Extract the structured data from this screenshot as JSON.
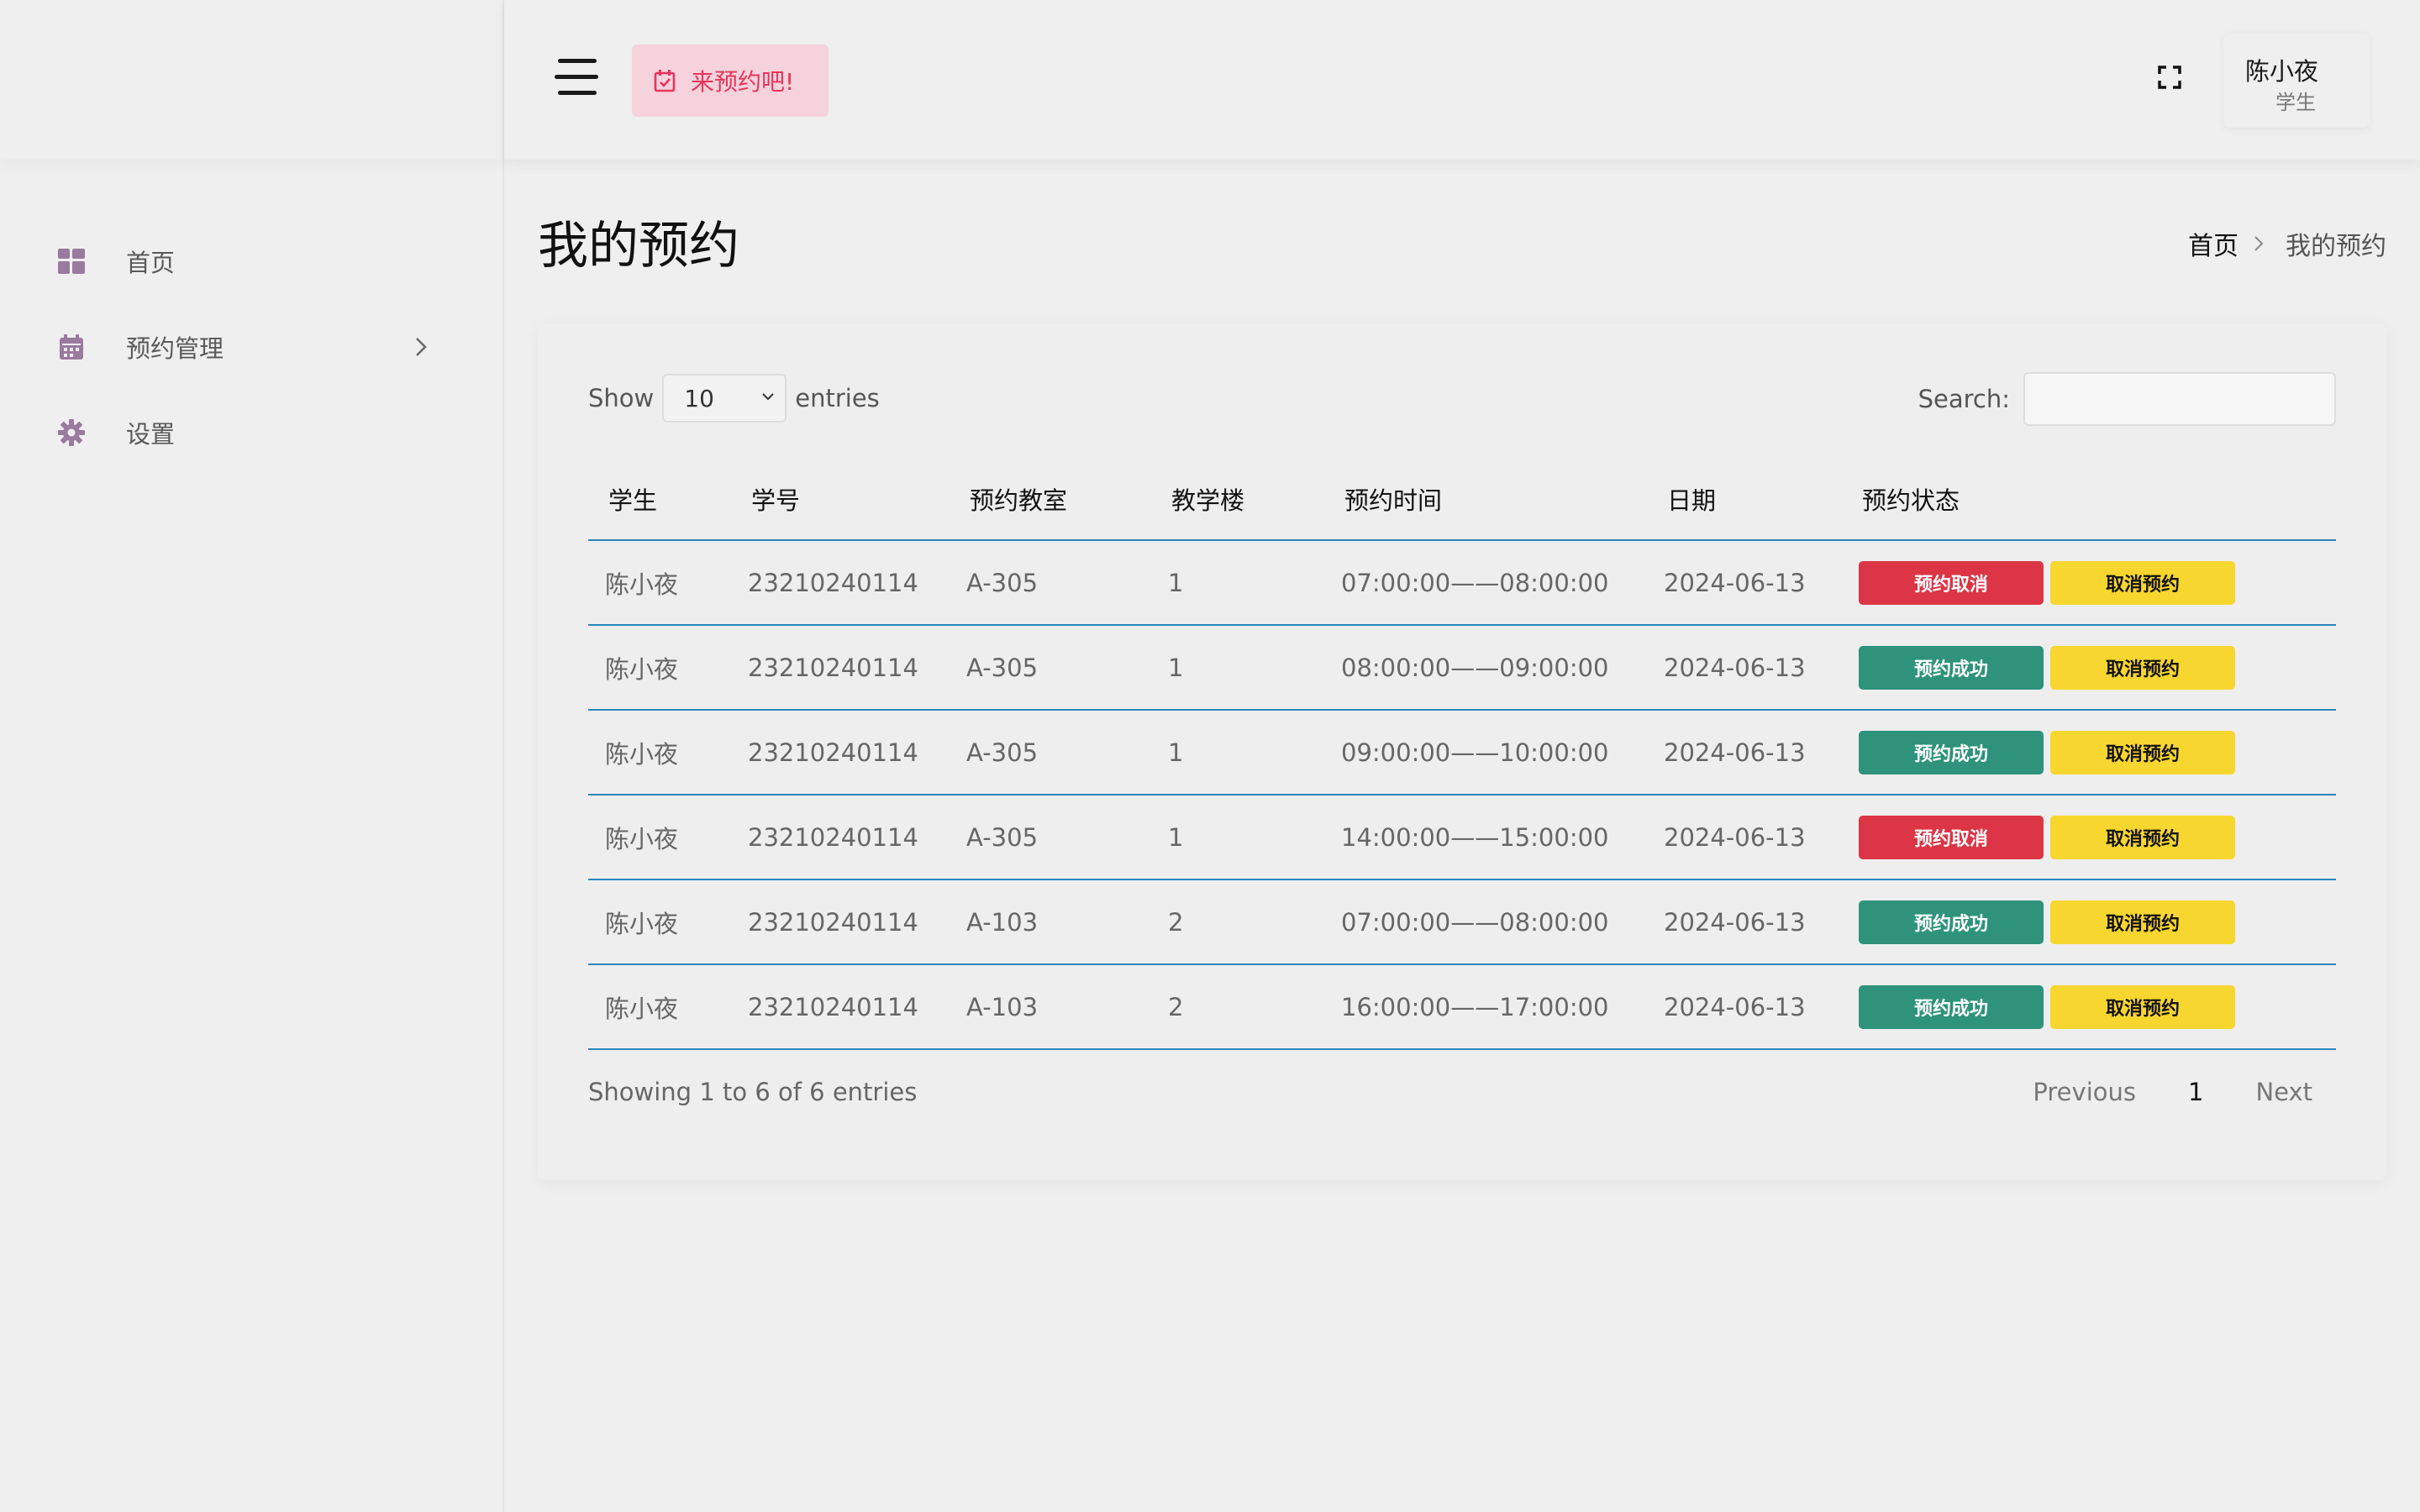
{
  "sidebar": {
    "items": [
      {
        "label": "首页",
        "icon": "dashboard-grid-icon"
      },
      {
        "label": "预约管理",
        "icon": "calendar-icon"
      },
      {
        "label": "设置",
        "icon": "gear-icon"
      }
    ]
  },
  "header": {
    "book_button_label": "来预约吧!",
    "user_name": "陈小夜",
    "user_role": "学生"
  },
  "page": {
    "title": "我的预约",
    "breadcrumb_home": "首页",
    "breadcrumb_current": "我的预约"
  },
  "table_controls": {
    "show_label": "Show",
    "entries_value": "10",
    "entries_label": "entries",
    "search_label": "Search:",
    "search_value": ""
  },
  "table": {
    "columns": [
      "学生",
      "学号",
      "预约教室",
      "教学楼",
      "预约时间",
      "日期",
      "预约状态"
    ],
    "rows": [
      {
        "student": "陈小夜",
        "id": "23210240114",
        "room": "A-305",
        "building": "1",
        "time": "07:00:00——08:00:00",
        "date": "2024-06-13",
        "status": "预约取消",
        "status_color": "#dc3545",
        "action": "取消预约"
      },
      {
        "student": "陈小夜",
        "id": "23210240114",
        "room": "A-305",
        "building": "1",
        "time": "08:00:00——09:00:00",
        "date": "2024-06-13",
        "status": "预约成功",
        "status_color": "#2e937a",
        "action": "取消预约"
      },
      {
        "student": "陈小夜",
        "id": "23210240114",
        "room": "A-305",
        "building": "1",
        "time": "09:00:00——10:00:00",
        "date": "2024-06-13",
        "status": "预约成功",
        "status_color": "#2e937a",
        "action": "取消预约"
      },
      {
        "student": "陈小夜",
        "id": "23210240114",
        "room": "A-305",
        "building": "1",
        "time": "14:00:00——15:00:00",
        "date": "2024-06-13",
        "status": "预约取消",
        "status_color": "#dc3545",
        "action": "取消预约"
      },
      {
        "student": "陈小夜",
        "id": "23210240114",
        "room": "A-103",
        "building": "2",
        "time": "07:00:00——08:00:00",
        "date": "2024-06-13",
        "status": "预约成功",
        "status_color": "#2e937a",
        "action": "取消预约"
      },
      {
        "student": "陈小夜",
        "id": "23210240114",
        "room": "A-103",
        "building": "2",
        "time": "16:00:00——17:00:00",
        "date": "2024-06-13",
        "status": "预约成功",
        "status_color": "#2e937a",
        "action": "取消预约"
      }
    ]
  },
  "footer": {
    "showing_text": "Showing 1 to 6 of 6 entries",
    "previous_label": "Previous",
    "current_page": "1",
    "next_label": "Next"
  },
  "colors": {
    "accent_line": "#2a87b8",
    "cancel_status": "#dc3545",
    "success_status": "#2e937a",
    "action_button": "#f8d630",
    "book_button_bg": "#f5d2dc",
    "book_button_text": "#e8345b",
    "sidebar_icon": "#9a7a9e"
  }
}
